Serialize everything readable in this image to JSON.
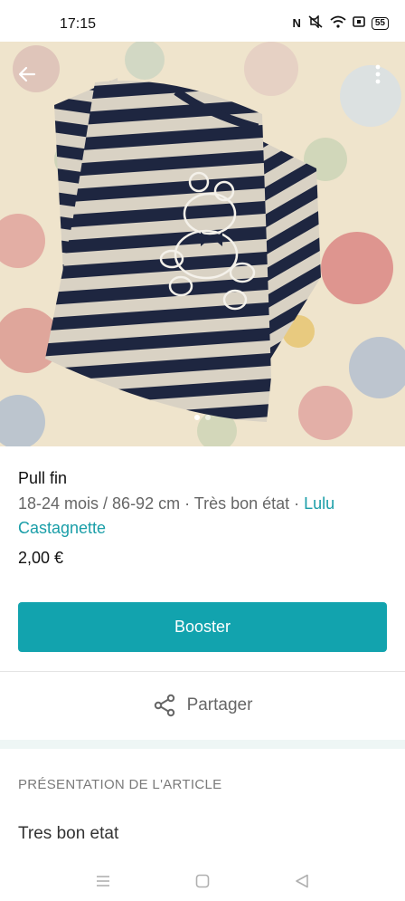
{
  "status_bar": {
    "time": "17:15",
    "nfc": "N",
    "battery": "55",
    "icons": [
      "nfc-icon",
      "mute-icon",
      "wifi-icon",
      "sim-icon",
      "battery-icon"
    ]
  },
  "product": {
    "title": "Pull fin",
    "meta": "18-24 mois / 86-92 cm · Très bon état · ",
    "brand": "Lulu Castagnette",
    "price": "2,00 €"
  },
  "photo": {
    "current_image": 1,
    "image_count": 2
  },
  "actions": {
    "booster_label": "Booster",
    "share_label": "Partager"
  },
  "section": {
    "title": "PRÉSENTATION DE L'ARTICLE",
    "description": "Tres bon etat"
  },
  "colors": {
    "accent": "#12a3ae",
    "brand_link": "#1a9ea8",
    "stripe_dark": "#1e2640",
    "stripe_light": "#d9d2c4"
  }
}
